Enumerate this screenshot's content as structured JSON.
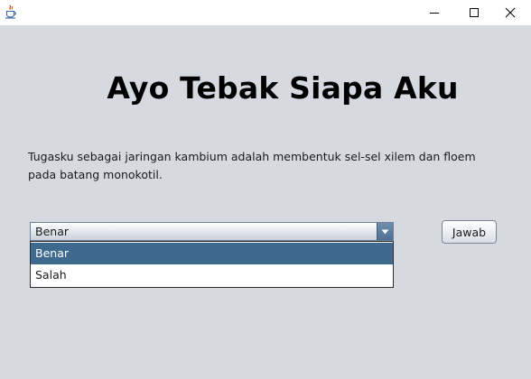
{
  "window": {
    "icon": "java-cup-icon",
    "controls": {
      "minimize_icon": "minimize-icon",
      "maximize_icon": "maximize-icon",
      "close_icon": "close-icon"
    }
  },
  "main": {
    "heading": "Ayo Tebak Siapa Aku",
    "question": "Tugasku sebagai jaringan kambium adalah membentuk sel-sel xilem dan floem pada batang monokotil.",
    "answer_select": {
      "value": "Benar",
      "options": [
        "Benar",
        "Salah"
      ],
      "arrow_icon": "chevron-down-icon"
    },
    "answer_button": "Jawab"
  },
  "colors": {
    "window_background": "#d6d9e0",
    "title_bar": "#ffffff",
    "selected_option": "#3d6a8e",
    "combo_arrow": "#4d6f93"
  }
}
